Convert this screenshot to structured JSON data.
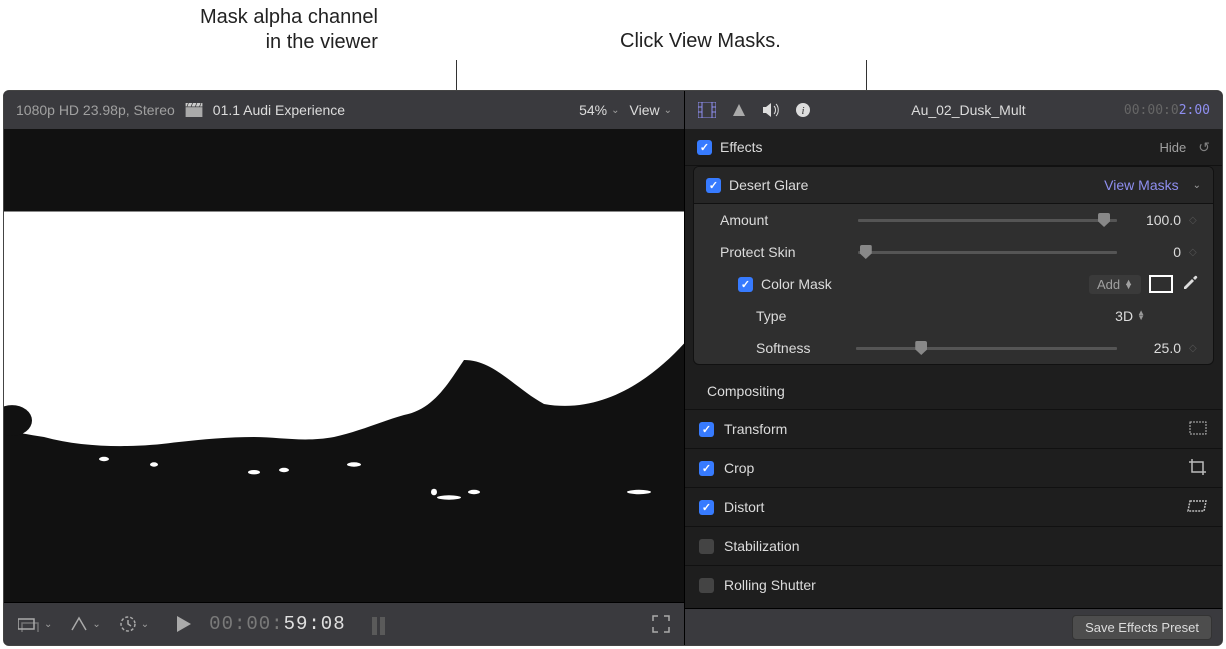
{
  "callouts": {
    "left_line1": "Mask alpha channel",
    "left_line2": "in the viewer",
    "right": "Click View Masks."
  },
  "viewer": {
    "format": "1080p HD 23.98p, Stereo",
    "project": "01.1 Audi Experience",
    "zoom": "54%",
    "view_label": "View"
  },
  "transport": {
    "tc_dim": "00:00:",
    "tc_bright": "59:08"
  },
  "inspector": {
    "clip_name": "Au_02_Dusk_Mult",
    "tc_prefix": "00:00:0",
    "tc_end": "2:00",
    "effects_label": "Effects",
    "hide_label": "Hide",
    "effect": {
      "name": "Desert Glare",
      "view_masks": "View Masks",
      "params": {
        "amount_label": "Amount",
        "amount_value": "100.0",
        "protect_label": "Protect Skin",
        "protect_value": "0",
        "colormask_label": "Color Mask",
        "colormask_add": "Add",
        "type_label": "Type",
        "type_value": "3D",
        "softness_label": "Softness",
        "softness_value": "25.0"
      }
    },
    "sections": {
      "compositing": "Compositing",
      "transform": "Transform",
      "crop": "Crop",
      "distort": "Distort",
      "stabilization": "Stabilization",
      "rolling": "Rolling Shutter"
    },
    "save_preset": "Save Effects Preset"
  }
}
